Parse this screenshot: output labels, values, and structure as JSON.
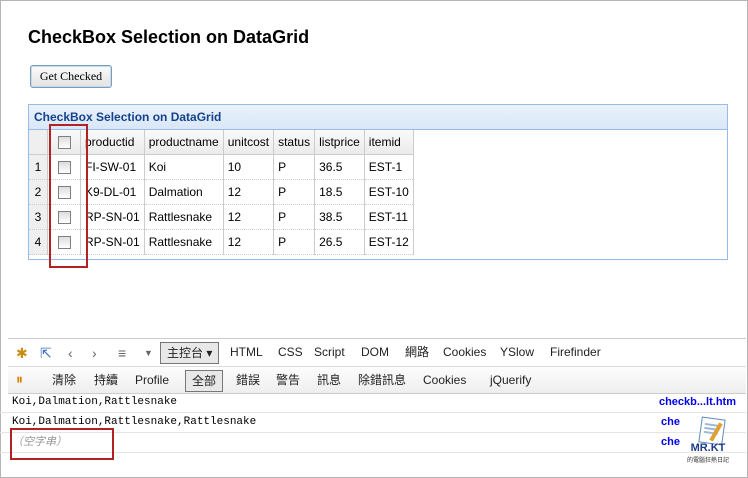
{
  "page": {
    "title": "CheckBox Selection on DataGrid",
    "button_label": "Get Checked"
  },
  "grid": {
    "title": "CheckBox Selection on DataGrid",
    "columns": [
      "productid",
      "productname",
      "unitcost",
      "status",
      "listprice",
      "itemid"
    ],
    "rows": [
      {
        "n": "1",
        "productid": "FI-SW-01",
        "productname": "Koi",
        "unitcost": "10",
        "status": "P",
        "listprice": "36.5",
        "itemid": "EST-1"
      },
      {
        "n": "2",
        "productid": "K9-DL-01",
        "productname": "Dalmation",
        "unitcost": "12",
        "status": "P",
        "listprice": "18.5",
        "itemid": "EST-10"
      },
      {
        "n": "3",
        "productid": "RP-SN-01",
        "productname": "Rattlesnake",
        "unitcost": "12",
        "status": "P",
        "listprice": "38.5",
        "itemid": "EST-11"
      },
      {
        "n": "4",
        "productid": "RP-SN-01",
        "productname": "Rattlesnake",
        "unitcost": "12",
        "status": "P",
        "listprice": "26.5",
        "itemid": "EST-12"
      }
    ]
  },
  "firebug": {
    "console_menu": "主控台",
    "tabs": [
      "HTML",
      "CSS",
      "Script",
      "DOM",
      "網路",
      "Cookies",
      "YSlow",
      "Firefinder"
    ],
    "subtoolbar": [
      "清除",
      "持續",
      "Profile",
      "全部",
      "錯誤",
      "警告",
      "訊息",
      "除錯訊息",
      "Cookies",
      "jQuerify"
    ],
    "console_lines": [
      {
        "text": "Koi,Dalmation,Rattlesnake",
        "source": "checkb...lt.htm"
      },
      {
        "text": "Koi,Dalmation,Rattlesnake,Rattlesnake",
        "source": "che"
      },
      {
        "text": "（空字串）",
        "source": "che"
      }
    ]
  },
  "logo": {
    "brand": "MR.KT",
    "sub": "的電腦狂熱日記"
  },
  "colors": {
    "grid_header_text": "#15428b",
    "grid_border": "#99bbe8",
    "highlight": "#b22222",
    "link": "#0000ee"
  }
}
